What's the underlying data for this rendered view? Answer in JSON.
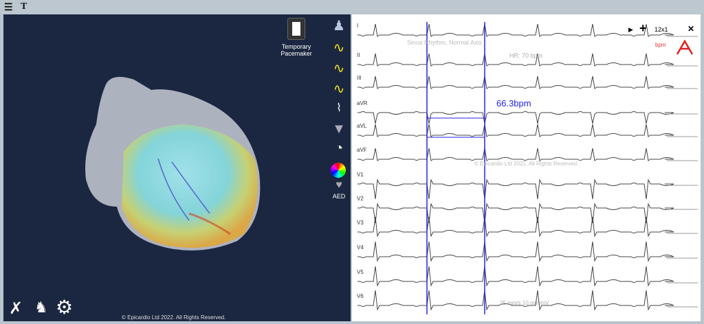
{
  "toolbar": {
    "menu_icon": "hamburger-icon",
    "text_tool_label": "T"
  },
  "left_panel": {
    "pacemaker_label_1": "Temporary",
    "pacemaker_label_2": "Pacemaker",
    "side_icons": [
      "torso-icon",
      "ecg-rhythm-icon",
      "ecg-12-lead-icon",
      "ecg-annotated-icon",
      "ecg-small-icon",
      "heart-cross-section-icon",
      "speedometer-icon",
      "color-wheel-icon",
      "aed-heart-icon"
    ],
    "aed_label": "AED",
    "bottom_icons": [
      "tools-icon",
      "hand-heart-icon",
      "gear-icon"
    ],
    "copyright": "© Epicardio Ltd 2022. All Rights Reserved."
  },
  "ecg": {
    "leads": [
      "I",
      "II",
      "III",
      "aVR",
      "aVL",
      "aVF",
      "V1",
      "V2",
      "V3",
      "V4",
      "V5",
      "V6"
    ],
    "rhythm": "Sinus Rhythm, Normal Axis",
    "hr": "HR: 70 bpm",
    "measurement": "66.3bpm",
    "layout_label": "12x1",
    "bpm_label": "bpm",
    "speed": "25 mm/s  10 mm/mV",
    "watermark": "© Epicardio Ltd 2022. All Rights Reserved.",
    "cursor_color": "#2222ee"
  }
}
